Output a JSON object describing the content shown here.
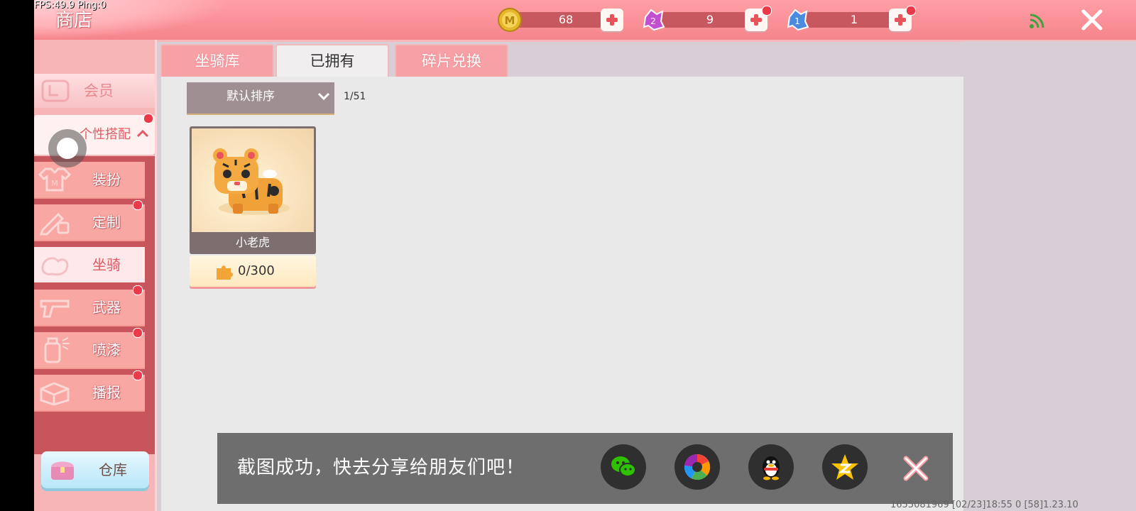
{
  "debug": {
    "fps_ping": "FPS:49.9  Ping:0"
  },
  "header": {
    "title": "商店",
    "currencies": [
      {
        "name": "coin",
        "icon": "coin-icon",
        "value": "68"
      },
      {
        "name": "purple-fragment",
        "icon": "purple-fragment-icon",
        "value": "9"
      },
      {
        "name": "blue-fragment",
        "icon": "blue-fragment-icon",
        "value": "1"
      }
    ]
  },
  "sidebar": {
    "member_label": "会员",
    "custom_label": "个性搭配",
    "items": [
      {
        "label": "装扮",
        "icon": "shirt-icon"
      },
      {
        "label": "定制",
        "icon": "pencil-icon"
      },
      {
        "label": "坐骑",
        "icon": "mount-icon"
      },
      {
        "label": "武器",
        "icon": "gun-icon"
      },
      {
        "label": "喷漆",
        "icon": "spray-can-icon"
      },
      {
        "label": "播报",
        "icon": "broadcast-icon"
      }
    ],
    "warehouse_label": "仓库"
  },
  "tabs": [
    {
      "label": "坐骑库"
    },
    {
      "label": "已拥有"
    },
    {
      "label": "碎片兑换"
    }
  ],
  "content": {
    "sort_label": "默认排序",
    "page_count": "1/51",
    "items": [
      {
        "name": "小老虎",
        "fragments": "0/300"
      }
    ]
  },
  "toast": {
    "message": "截图成功，快去分享给朋友们吧！",
    "share_targets": [
      "wechat",
      "moments",
      "qq",
      "qzone"
    ]
  },
  "footer": {
    "info": "1655081969    [02/23]18:55 0   [58]1.23.10"
  },
  "colors": {
    "accent": "#f6848c",
    "selected_text": "#e15a63",
    "reddot": "#ea3a4a"
  }
}
